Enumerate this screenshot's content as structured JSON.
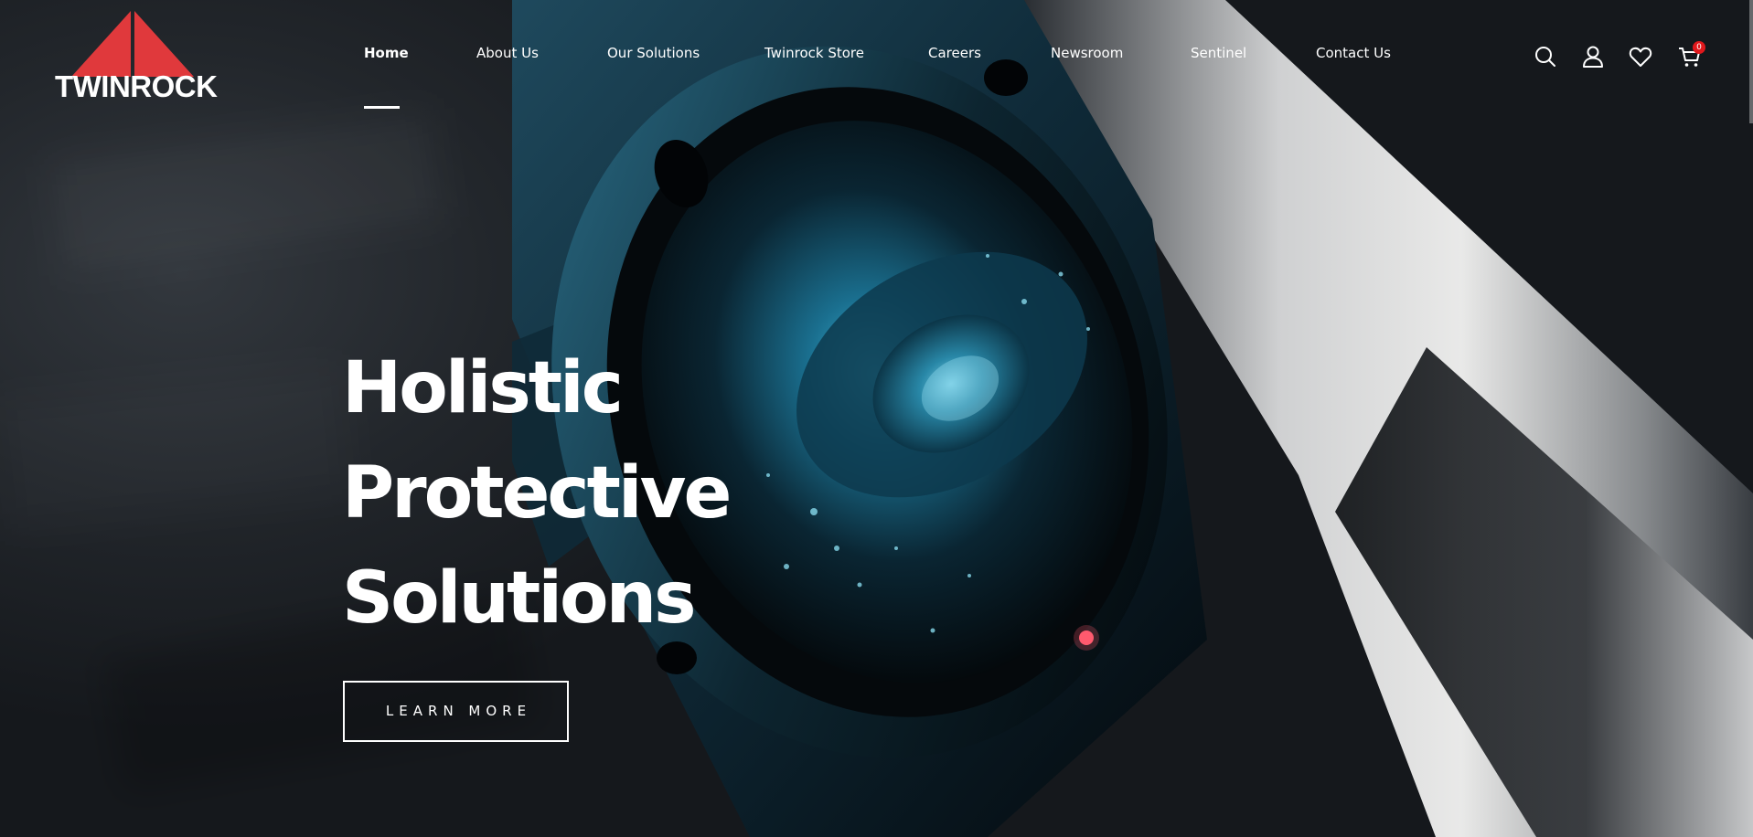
{
  "brand": {
    "name": "TWINROCK",
    "logo_icon": "red-triangle-split",
    "accent_color": "#e0393c"
  },
  "nav": {
    "items": [
      {
        "label": "Home",
        "active": true
      },
      {
        "label": "About Us"
      },
      {
        "label": "Our Solutions"
      },
      {
        "label": "Twinrock Store"
      },
      {
        "label": "Careers"
      },
      {
        "label": "Newsroom"
      },
      {
        "label": "Sentinel"
      },
      {
        "label": "Contact Us"
      }
    ]
  },
  "header_icons": {
    "search": "search-icon",
    "account": "user-icon",
    "wishlist": "heart-icon",
    "cart": "cart-icon",
    "cart_count": "0",
    "badge_color": "#e1181c"
  },
  "hero": {
    "title_lines": [
      "Holistic",
      "Protective",
      "Solutions"
    ],
    "cta_label": "LEARN MORE",
    "image": "security-camera-closeup"
  }
}
